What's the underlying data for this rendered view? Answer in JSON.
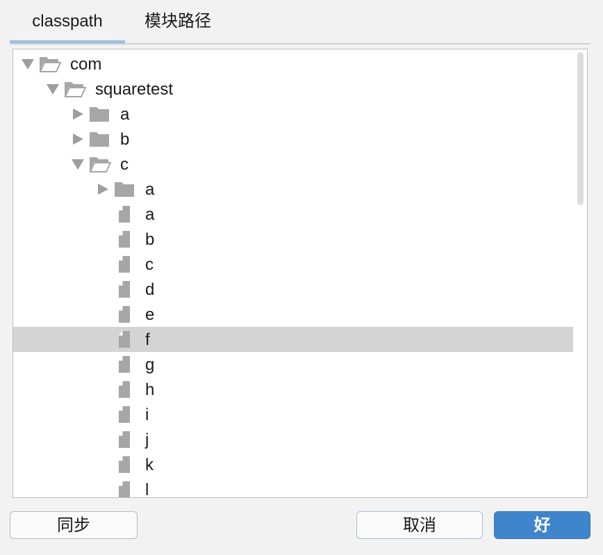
{
  "tabs": [
    {
      "label": "classpath",
      "active": true
    },
    {
      "label": "模块路径",
      "active": false
    }
  ],
  "tree": {
    "rows": [
      {
        "label": "com",
        "depth": 0,
        "type": "folder",
        "expanded": true
      },
      {
        "label": "squaretest",
        "depth": 1,
        "type": "folder",
        "expanded": true
      },
      {
        "label": "a",
        "depth": 2,
        "type": "folder",
        "expanded": false
      },
      {
        "label": "b",
        "depth": 2,
        "type": "folder",
        "expanded": false
      },
      {
        "label": "c",
        "depth": 2,
        "type": "folder",
        "expanded": true
      },
      {
        "label": "a",
        "depth": 3,
        "type": "folder",
        "expanded": false
      },
      {
        "label": "a",
        "depth": 3,
        "type": "file"
      },
      {
        "label": "b",
        "depth": 3,
        "type": "file"
      },
      {
        "label": "c",
        "depth": 3,
        "type": "file"
      },
      {
        "label": "d",
        "depth": 3,
        "type": "file"
      },
      {
        "label": "e",
        "depth": 3,
        "type": "file"
      },
      {
        "label": "f",
        "depth": 3,
        "type": "file",
        "selected": true
      },
      {
        "label": "g",
        "depth": 3,
        "type": "file"
      },
      {
        "label": "h",
        "depth": 3,
        "type": "file"
      },
      {
        "label": "i",
        "depth": 3,
        "type": "file"
      },
      {
        "label": "j",
        "depth": 3,
        "type": "file"
      },
      {
        "label": "k",
        "depth": 3,
        "type": "file"
      },
      {
        "label": "l",
        "depth": 3,
        "type": "file"
      }
    ]
  },
  "buttons": {
    "sync": "同步",
    "cancel": "取消",
    "ok": "好"
  },
  "colors": {
    "accent": "#3f85cc",
    "tab_underline": "#9bbde3",
    "selection": "#d4d4d4",
    "icon": "#a6a6a6"
  }
}
